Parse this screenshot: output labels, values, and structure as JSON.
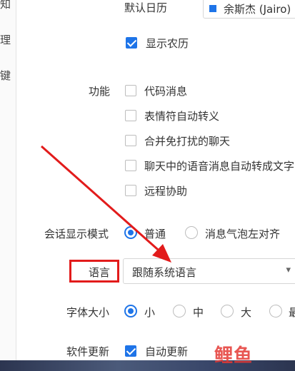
{
  "sidebar": {
    "chars": [
      "知",
      "理",
      "键"
    ]
  },
  "calendar": {
    "label": "默认日历",
    "selected": "余斯杰 (Jairo)",
    "accent": "#1e74e8",
    "show_lunar": {
      "label": "显示农历",
      "checked": true
    }
  },
  "features": {
    "label": "功能",
    "options": [
      {
        "label": "代码消息",
        "checked": false
      },
      {
        "label": "表情符自动转义",
        "checked": false
      },
      {
        "label": "合并免打扰的聊天",
        "checked": false
      },
      {
        "label": "聊天中的语音消息自动转成文字",
        "checked": false
      },
      {
        "label": "远程协助",
        "checked": false
      }
    ]
  },
  "display_mode": {
    "label": "会话显示模式",
    "options": [
      {
        "label": "普通",
        "selected": true
      },
      {
        "label": "消息气泡左对齐",
        "selected": false
      }
    ]
  },
  "language": {
    "label": "语言",
    "selected": "跟随系统语言",
    "chevron": "chevron-down-icon"
  },
  "font_size": {
    "label": "字体大小",
    "options": [
      {
        "label": "小",
        "selected": true
      },
      {
        "label": "中",
        "selected": false
      },
      {
        "label": "大",
        "selected": false
      },
      {
        "label": "最",
        "selected": false
      }
    ]
  },
  "software_update": {
    "label": "软件更新",
    "option": {
      "label": "自动更新",
      "checked": true
    }
  },
  "annotation": {
    "color": "#e21b1b"
  },
  "watermark": "鲤鱼"
}
